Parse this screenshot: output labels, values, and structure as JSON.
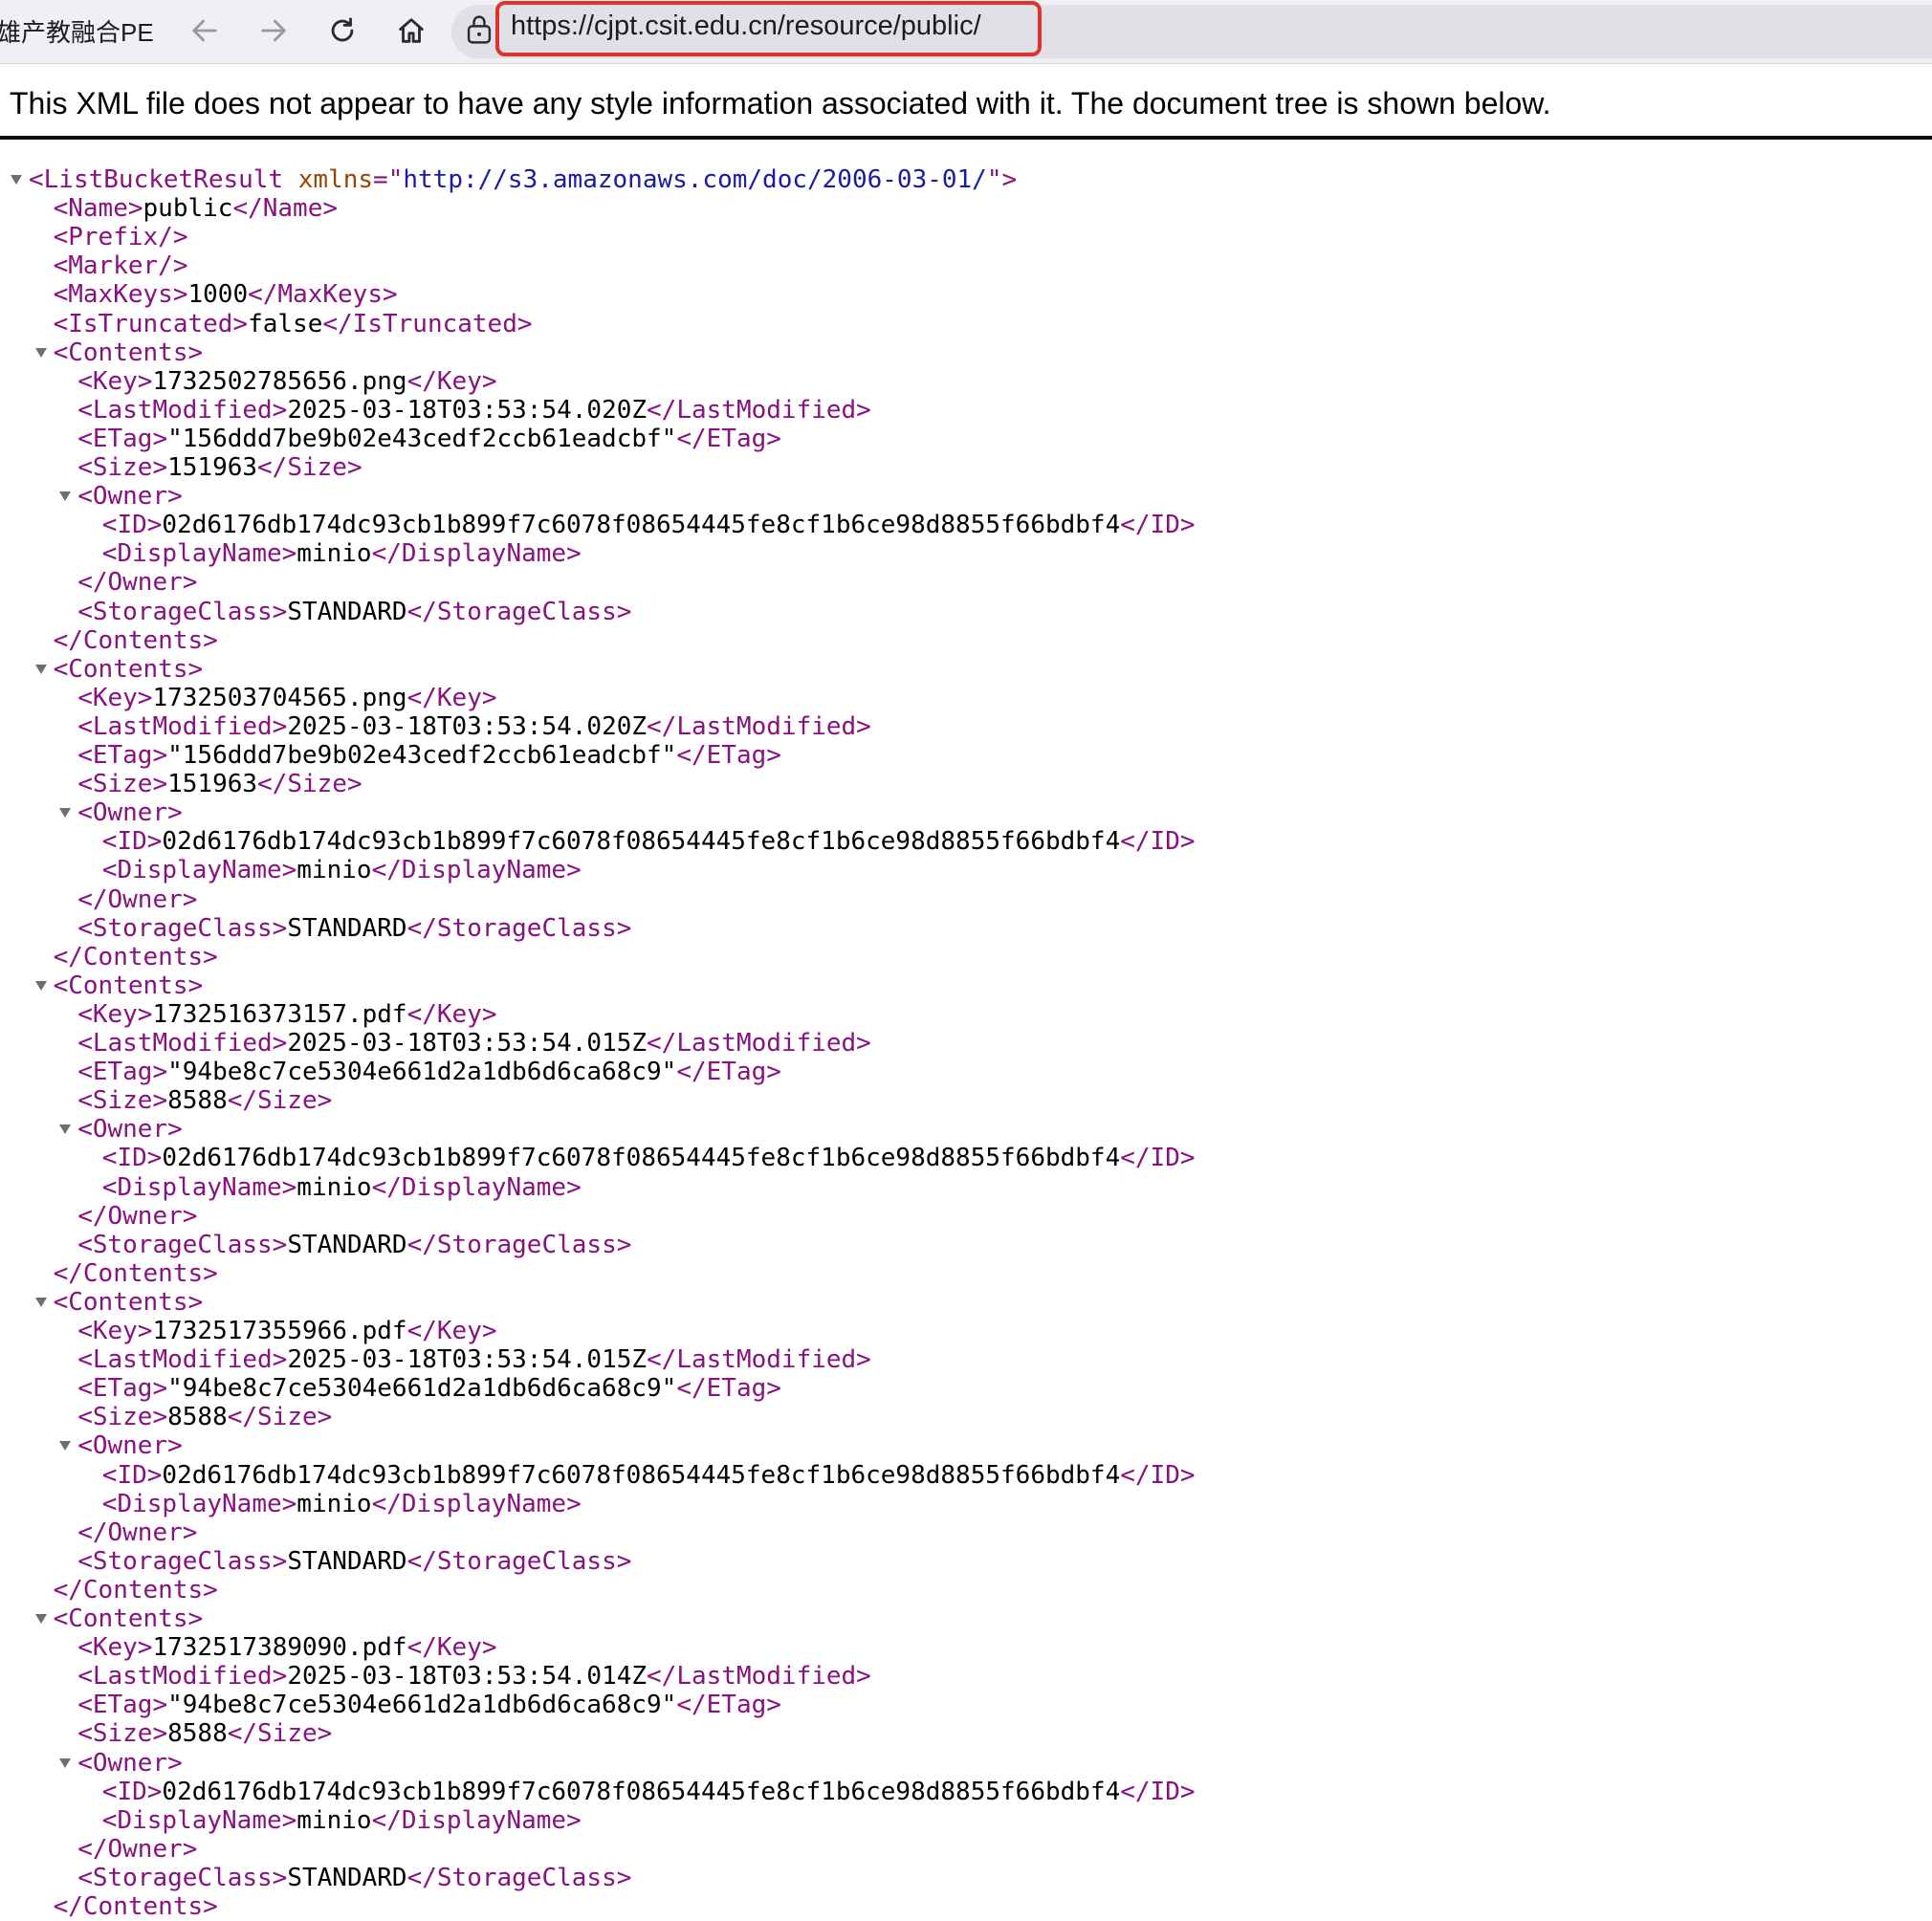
{
  "browser": {
    "tab_title": "雄产教融合PE",
    "url": "https://cjpt.csit.edu.cn/resource/public/",
    "icons": [
      "back-arrow-icon",
      "forward-arrow-icon",
      "reload-icon",
      "home-icon",
      "lock-icon"
    ]
  },
  "viewer": {
    "notice": "This XML file does not appear to have any style information associated with it. The document tree is shown below."
  },
  "xml": {
    "root_tag": "ListBucketResult",
    "root_attr_name": "xmlns",
    "root_attr_value": "http://s3.amazonaws.com/doc/2006-03-01/",
    "name": "public",
    "max_keys": "1000",
    "is_truncated": "false",
    "contents": [
      {
        "key": "1732502785656.png",
        "last_modified": "2025-03-18T03:53:54.020Z",
        "etag": "\"156ddd7be9b02e43cedf2ccb61eadcbf\"",
        "size": "151963",
        "owner_id": "02d6176db174dc93cb1b899f7c6078f08654445fe8cf1b6ce98d8855f66bdbf4",
        "owner_display_name": "minio",
        "storage_class": "STANDARD"
      },
      {
        "key": "1732503704565.png",
        "last_modified": "2025-03-18T03:53:54.020Z",
        "etag": "\"156ddd7be9b02e43cedf2ccb61eadcbf\"",
        "size": "151963",
        "owner_id": "02d6176db174dc93cb1b899f7c6078f08654445fe8cf1b6ce98d8855f66bdbf4",
        "owner_display_name": "minio",
        "storage_class": "STANDARD"
      },
      {
        "key": "1732516373157.pdf",
        "last_modified": "2025-03-18T03:53:54.015Z",
        "etag": "\"94be8c7ce5304e661d2a1db6d6ca68c9\"",
        "size": "8588",
        "owner_id": "02d6176db174dc93cb1b899f7c6078f08654445fe8cf1b6ce98d8855f66bdbf4",
        "owner_display_name": "minio",
        "storage_class": "STANDARD"
      },
      {
        "key": "1732517355966.pdf",
        "last_modified": "2025-03-18T03:53:54.015Z",
        "etag": "\"94be8c7ce5304e661d2a1db6d6ca68c9\"",
        "size": "8588",
        "owner_id": "02d6176db174dc93cb1b899f7c6078f08654445fe8cf1b6ce98d8855f66bdbf4",
        "owner_display_name": "minio",
        "storage_class": "STANDARD"
      },
      {
        "key": "1732517389090.pdf",
        "last_modified": "2025-03-18T03:53:54.014Z",
        "etag": "\"94be8c7ce5304e661d2a1db6d6ca68c9\"",
        "size": "8588",
        "owner_id": "02d6176db174dc93cb1b899f7c6078f08654445fe8cf1b6ce98d8855f66bdbf4",
        "owner_display_name": "minio",
        "storage_class": "STANDARD"
      }
    ]
  }
}
